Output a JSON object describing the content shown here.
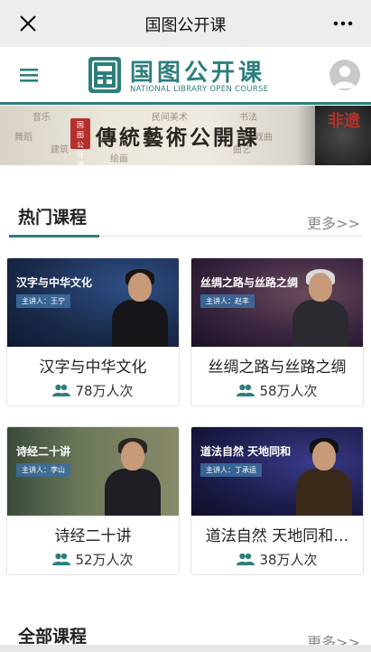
{
  "topbar": {
    "title": "国图公开课",
    "close_icon": "close-icon",
    "more_icon": "more-dots-icon"
  },
  "header": {
    "logo_name": "国图公开课",
    "logo_en": "NATIONAL LIBRARY OPEN COURSE",
    "brand_color": "#2d7f7d"
  },
  "banner": {
    "title": "傳統藝術公開課",
    "seal_text": "国图公开课",
    "corner_text": "非遗",
    "deco": [
      "音乐",
      "民间美术",
      "书法",
      "舞蹈",
      "戏曲",
      "建筑",
      "曲艺",
      "绘画"
    ]
  },
  "hot_section": {
    "title": "热门课程",
    "more": "更多>>"
  },
  "all_section": {
    "title": "全部课程",
    "more": "更多>>"
  },
  "courses": [
    {
      "thumb_title": "汉字与中华文化",
      "thumb_sub": "主讲人：王宁",
      "name": "汉字与中华文化",
      "views": "78万人次"
    },
    {
      "thumb_title": "丝绸之路与丝路之绸",
      "thumb_sub": "主讲人：赵丰",
      "name": "丝绸之路与丝路之绸",
      "views": "58万人次"
    },
    {
      "thumb_title": "诗经二十讲",
      "thumb_sub": "主讲人：李山",
      "name": "诗经二十讲",
      "views": "52万人次"
    },
    {
      "thumb_title": "道法自然 天地同和",
      "thumb_sub": "主讲人：丁承运",
      "name": "道法自然 天地同和…",
      "views": "38万人次"
    }
  ]
}
